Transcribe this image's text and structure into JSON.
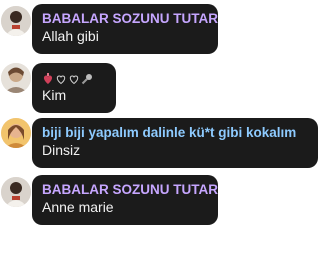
{
  "messages": [
    {
      "author": "BABALAR SOZUNU TUTAR",
      "text": "Allah gibi",
      "avatar_icon": "person-photo-icon"
    },
    {
      "author_icons": [
        "anatomical-heart-icon",
        "heart-outline-icon",
        "heart-outline-icon",
        "microphone-icon"
      ],
      "text": "Kim",
      "avatar_icon": "person-photo-icon"
    },
    {
      "author": "biji biji yapalım dalinle kü*t gibi kokalım",
      "text": "Dinsiz",
      "avatar_icon": "person-photo-icon"
    },
    {
      "author": "BABALAR SOZUNU TUTAR",
      "text": "Anne marie",
      "avatar_icon": "person-photo-icon"
    }
  ],
  "colors": {
    "bubble": "#1b1b1b",
    "name_purple": "#c6a6ff",
    "name_blue": "#8ecbff",
    "text": "#f2f2f2"
  }
}
